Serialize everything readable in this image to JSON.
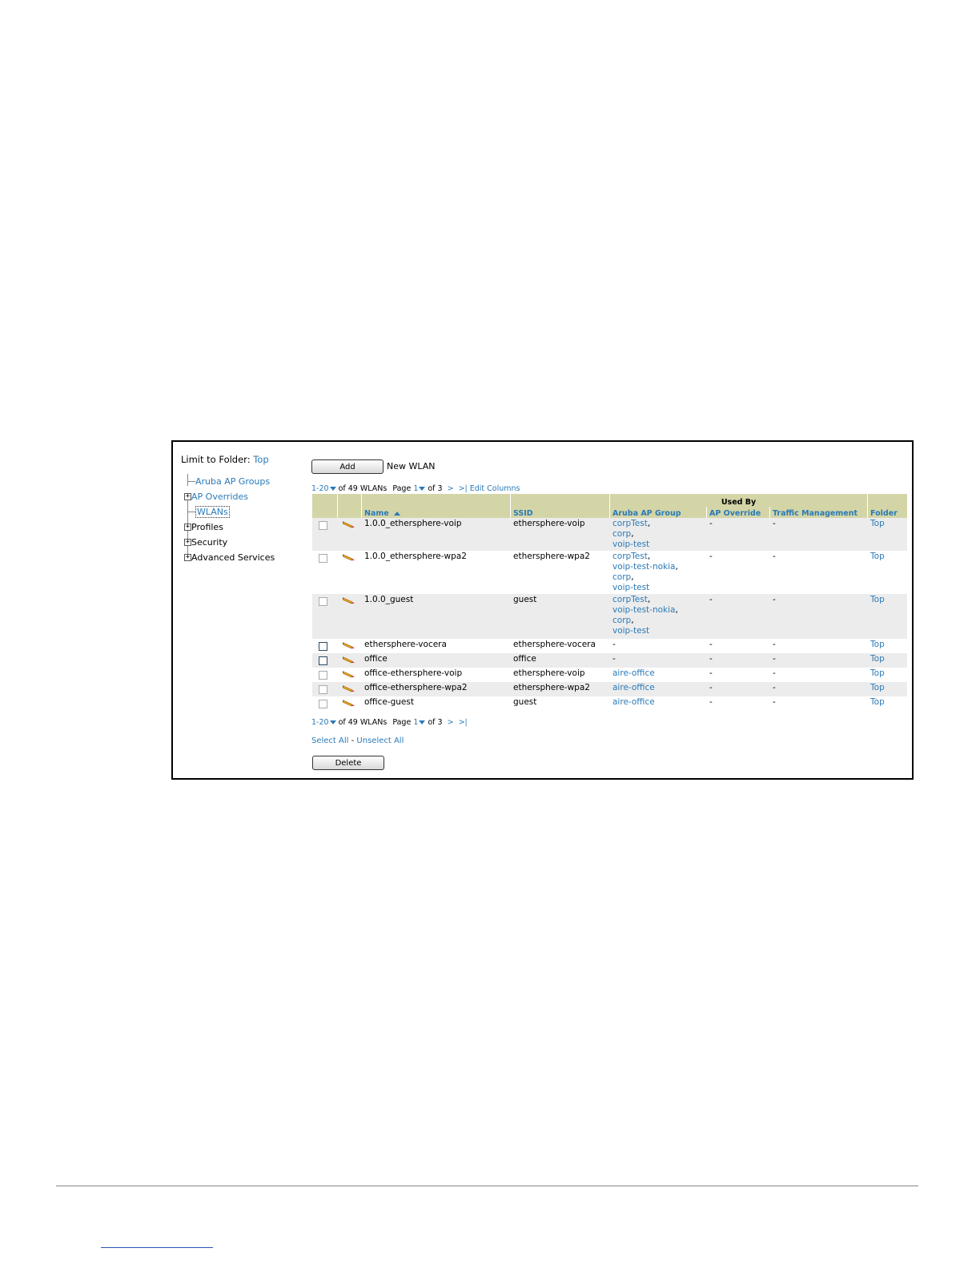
{
  "tree": {
    "limit_label": "Limit to Folder:",
    "limit_value": "Top",
    "items": [
      {
        "label": "Aruba AP Groups",
        "link": true,
        "expander": ""
      },
      {
        "label": "AP Overrides",
        "link": true,
        "expander": "+"
      },
      {
        "label": "WLANs",
        "link": true,
        "expander": ""
      },
      {
        "label": "Profiles",
        "link": false,
        "expander": "+"
      },
      {
        "label": "Security",
        "link": false,
        "expander": "+"
      },
      {
        "label": "Advanced Services",
        "link": false,
        "expander": "+"
      }
    ]
  },
  "toolbar": {
    "add_label": "Add",
    "new_label": "New WLAN"
  },
  "pager_top": {
    "range": "1-20",
    "of_total": "of 49 WLANs",
    "page_label": "Page",
    "page_num": "1",
    "of_pages": "of 3",
    "next": ">",
    "last": ">|",
    "edit_columns": "Edit Columns"
  },
  "pager_bottom": {
    "range": "1-20",
    "of_total": "of 49 WLANs",
    "page_label": "Page",
    "page_num": "1",
    "of_pages": "of 3",
    "next": ">",
    "last": ">|"
  },
  "table": {
    "group_header": "Used By",
    "columns": [
      "Name",
      "SSID",
      "Aruba AP Group",
      "AP Override",
      "Traffic Management",
      "Folder"
    ],
    "rows": [
      {
        "name": "1.0.0_ethersphere-voip",
        "ssid": "ethersphere-voip",
        "groups": [
          "corpTest",
          "corp",
          "voip-test"
        ],
        "override": "-",
        "traffic": "-",
        "folder": "Top"
      },
      {
        "name": "1.0.0_ethersphere-wpa2",
        "ssid": "ethersphere-wpa2",
        "groups": [
          "corpTest",
          "voip-test-nokia",
          "corp",
          "voip-test"
        ],
        "override": "-",
        "traffic": "-",
        "folder": "Top"
      },
      {
        "name": "1.0.0_guest",
        "ssid": "guest",
        "groups": [
          "corpTest",
          "voip-test-nokia",
          "corp",
          "voip-test"
        ],
        "override": "-",
        "traffic": "-",
        "folder": "Top"
      },
      {
        "name": "ethersphere-vocera",
        "ssid": "ethersphere-vocera",
        "groups": [],
        "groups_text": "-",
        "override": "-",
        "traffic": "-",
        "folder": "Top"
      },
      {
        "name": "office",
        "ssid": "office",
        "groups": [],
        "groups_text": "-",
        "override": "-",
        "traffic": "-",
        "folder": "Top"
      },
      {
        "name": "office-ethersphere-voip",
        "ssid": "ethersphere-voip",
        "groups": [
          "aire-office"
        ],
        "override": "-",
        "traffic": "-",
        "folder": "Top"
      },
      {
        "name": "office-ethersphere-wpa2",
        "ssid": "ethersphere-wpa2",
        "groups": [
          "aire-office"
        ],
        "override": "-",
        "traffic": "-",
        "folder": "Top"
      },
      {
        "name": "office-guest",
        "ssid": "guest",
        "groups": [
          "aire-office"
        ],
        "override": "-",
        "traffic": "-",
        "folder": "Top"
      }
    ]
  },
  "selection": {
    "select_all": "Select All",
    "separator": "-",
    "unselect_all": "Unselect All"
  },
  "delete_label": "Delete",
  "colors": {
    "link": "#2a7ab8",
    "header_bg": "#d3d5a7",
    "row_alt": "#ececec"
  }
}
